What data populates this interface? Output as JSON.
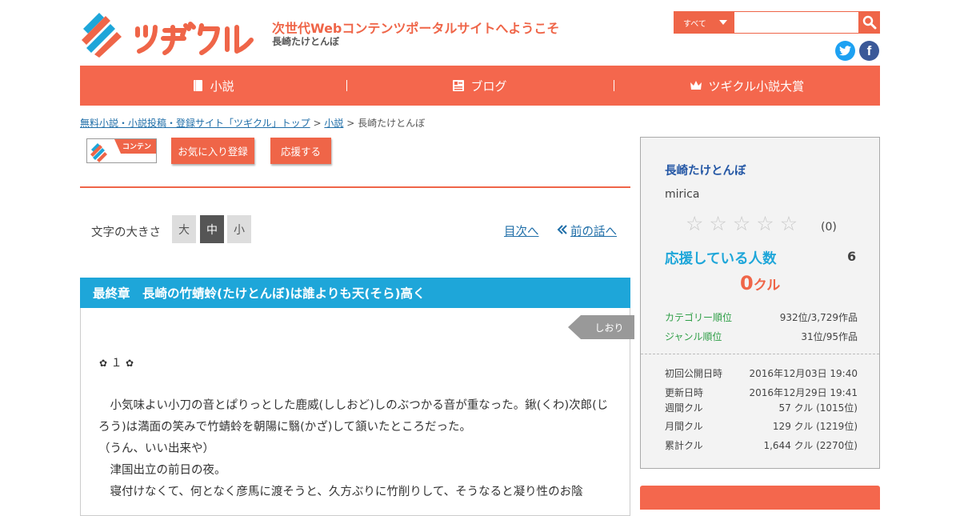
{
  "header": {
    "logo_text": "ツギクル",
    "tagline": "次世代Webコンテンツポータルサイトへようこそ",
    "subtitle": "長崎たけとんぼ",
    "search": {
      "category": "すべて",
      "placeholder": "",
      "value": ""
    },
    "social": [
      "twitter-icon",
      "facebook-icon"
    ]
  },
  "nav": [
    {
      "label": "小説",
      "icon": "book-icon"
    },
    {
      "label": "ブログ",
      "icon": "blog-icon"
    },
    {
      "label": "ツギクル小説大賞",
      "icon": "crown-icon"
    }
  ],
  "breadcrumb": {
    "home": "無料小説・小説投稿・登録サイト「ツギクル」トップ",
    "sep": ">",
    "novel": "小説",
    "current": "長崎たけとんぼ"
  },
  "actions": {
    "badge_text": "コンテンツ",
    "favorite": "お気に入り登録",
    "cheer": "応援する"
  },
  "font_size": {
    "label": "文字の大きさ",
    "large": "大",
    "medium": "中",
    "small": "小",
    "selected": "中"
  },
  "links": {
    "toc": "目次へ",
    "prev": "前の話へ"
  },
  "chapter": {
    "title": "最終章　長崎の竹蜻蛉(たけとんぼ)は誰よりも天(そら)高く",
    "bookmark": "しおり",
    "section": "１",
    "lines": [
      "　小気味よい小刀の音とぱりっとした鹿威(ししおど)しのぶつかる音が重なった。鍬(くわ)次郎(じろう)は満面の笑みで竹蜻蛉を朝陽に翳(かざ)して頷いたところだった。",
      "（うん、いい出来や）",
      "　津国出立の前日の夜。",
      "　寝付けなくて、何となく彦馬に渡そうと、久方ぶりに竹削りして、そうなると凝り性のお陰"
    ]
  },
  "sidebar": {
    "title": "長崎たけとんぼ",
    "author": "mirica",
    "rating": 0,
    "rating_count": "(0)",
    "cheer_label": "応援している人数",
    "cheer_count": "6",
    "kuru_value": "0",
    "kuru_unit": "クル",
    "ranks": [
      {
        "label": "カテゴリー順位",
        "value": "932位/3,729作品"
      },
      {
        "label": "ジャンル順位",
        "value": "31位/95作品"
      }
    ],
    "stats": [
      {
        "label": "初回公開日時",
        "value": "2016年12月03日 19:40"
      },
      {
        "label": "更新日時",
        "value": "2016年12月29日 19:41"
      },
      {
        "label": "週間クル",
        "value": "57 クル (1015位)"
      },
      {
        "label": "月間クル",
        "value": "129 クル (1219位)"
      },
      {
        "label": "累計クル",
        "value": "1,644 クル (2270位)"
      }
    ]
  },
  "colors": {
    "brand": "#ef6548",
    "accent_blue": "#1ea6d9",
    "link": "#1f6ea8",
    "rank_green": "#2e9e46"
  }
}
